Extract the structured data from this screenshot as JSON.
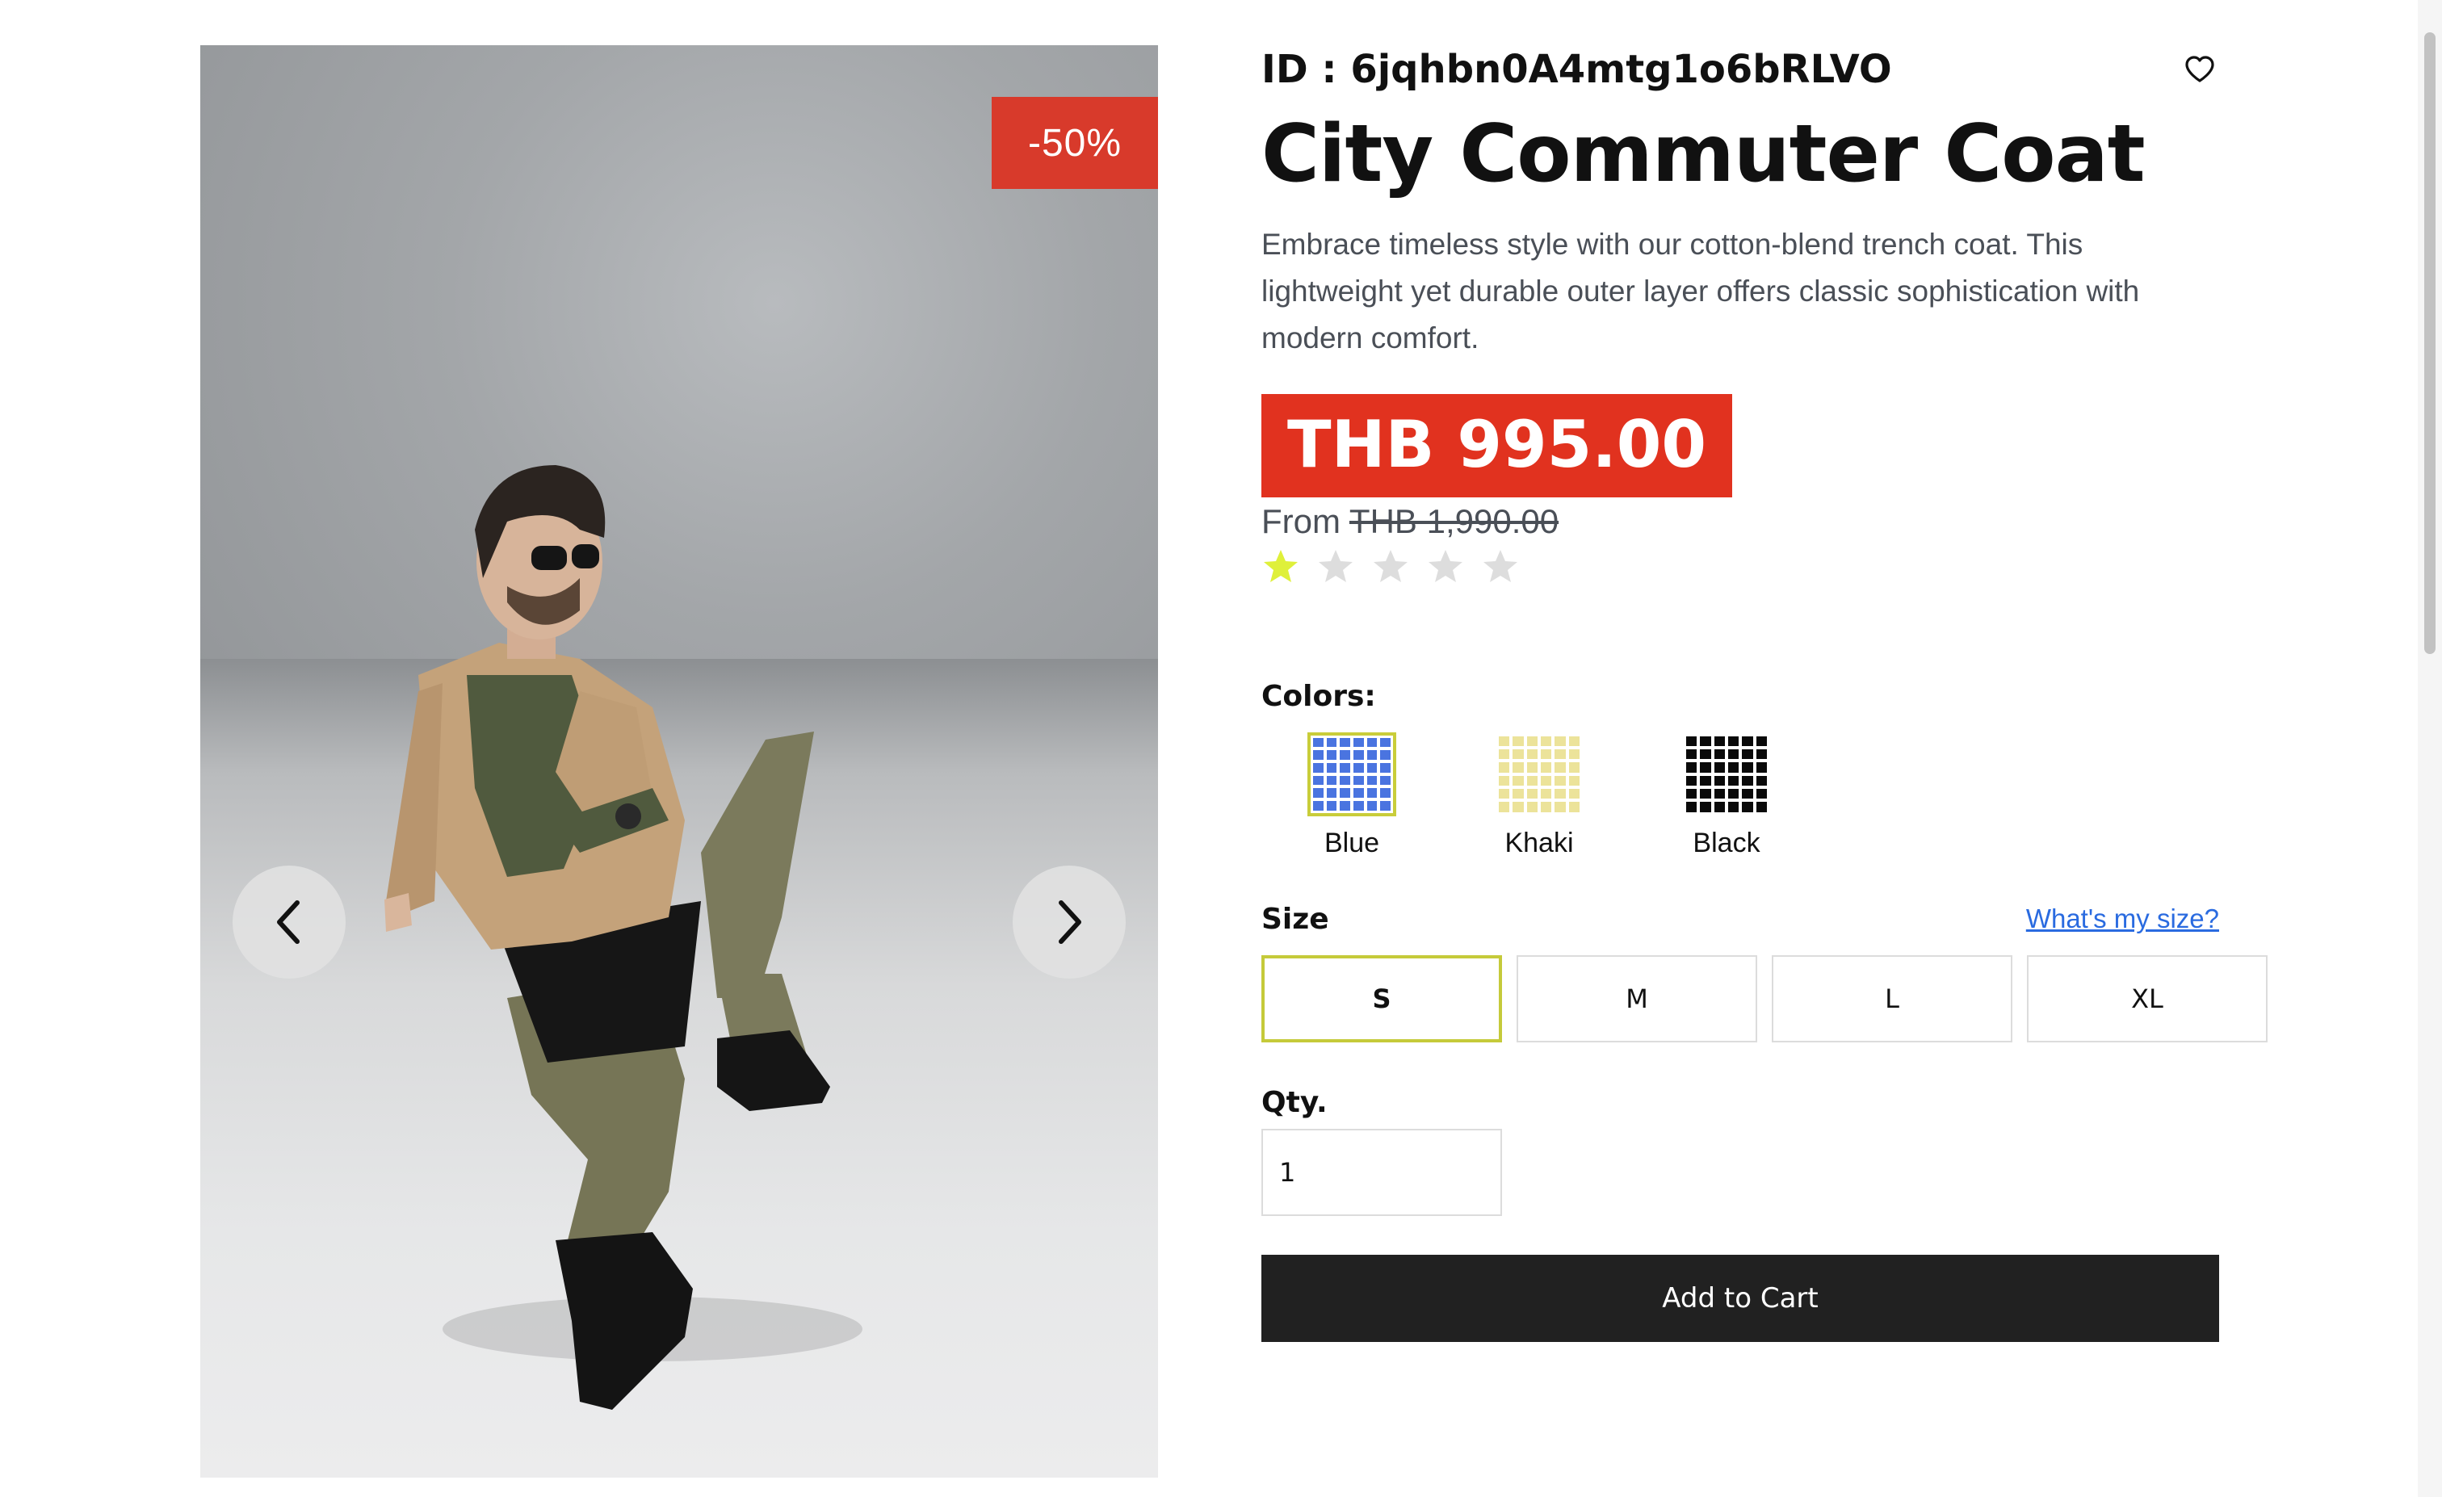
{
  "gallery": {
    "discount_badge": "-50%",
    "prev_icon": "chevron-left-icon",
    "next_icon": "chevron-right-icon"
  },
  "product": {
    "id_label": "ID : 6jqhbn0A4mtg1o6bRLVO",
    "title": "City Commuter Coat",
    "description": "Embrace timeless style with our cotton-blend trench coat. This lightweight yet durable outer layer offers classic sophistication with modern comfort.",
    "price": "THB 995.00",
    "from_label": "From",
    "original_price": "THB 1,990.00",
    "rating": 1,
    "rating_max": 5,
    "wishlist_icon": "heart-icon"
  },
  "colors": {
    "label": "Colors:",
    "options": [
      {
        "name": "Blue",
        "hex": "#4a74e0",
        "selected": true
      },
      {
        "name": "Khaki",
        "hex": "#ece39a",
        "selected": false
      },
      {
        "name": "Black",
        "hex": "#0a0a0a",
        "selected": false
      }
    ]
  },
  "size": {
    "label": "Size",
    "guide_link": "What's my size?",
    "options": [
      "S",
      "M",
      "L",
      "XL"
    ],
    "selected": "S"
  },
  "qty": {
    "label": "Qty.",
    "value": "1"
  },
  "cart": {
    "button_label": "Add to Cart"
  },
  "theme": {
    "price_red": "#e1321f",
    "badge_red": "#d83a2b",
    "star_active": "#dff03a",
    "star_inactive": "#dddddd",
    "selected_border": "#c5ca3a",
    "link_blue": "#2a6be0",
    "button_dark": "#212121"
  }
}
